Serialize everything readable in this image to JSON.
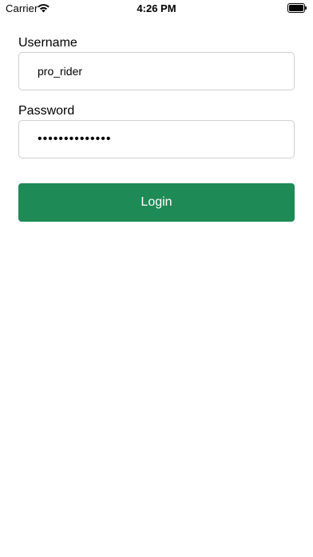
{
  "status_bar": {
    "carrier": "Carrier",
    "time": "4:26 PM",
    "wifi_icon": "wifi-icon",
    "battery_icon": "battery-icon"
  },
  "login_form": {
    "username_label": "Username",
    "username_value": "pro_rider",
    "password_label": "Password",
    "password_value": "••••••••••••••",
    "login_label": "Login"
  },
  "colors": {
    "primary_button": "#1e8a56",
    "field_border": "#cfcfcf"
  }
}
